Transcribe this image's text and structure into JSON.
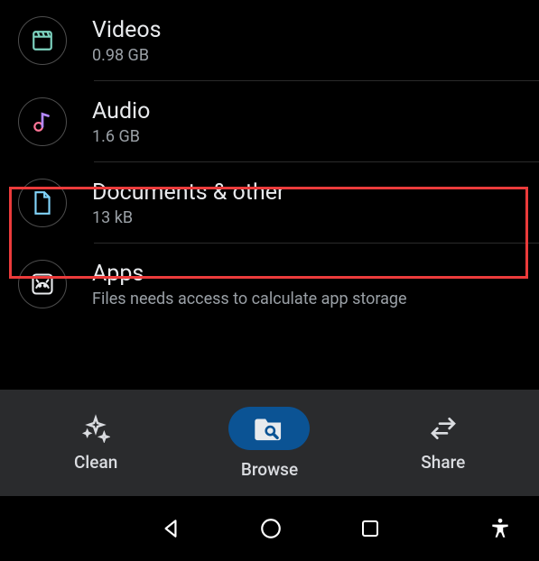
{
  "categories": [
    {
      "id": "videos",
      "label": "Videos",
      "sub": "0.98 GB",
      "icon": "clapperboard",
      "iconColor": "#7dd3c0"
    },
    {
      "id": "audio",
      "label": "Audio",
      "sub": "1.6 GB",
      "icon": "note",
      "iconColor": "#b388ff"
    },
    {
      "id": "documents",
      "label": "Documents & other",
      "sub": "13 kB",
      "icon": "doc",
      "iconColor": "#81d4fa"
    },
    {
      "id": "apps",
      "label": "Apps",
      "sub": "Files needs access to calculate app storage",
      "icon": "android",
      "iconColor": "#e8eaed"
    }
  ],
  "bottomNav": {
    "clean": "Clean",
    "browse": "Browse",
    "share": "Share",
    "activeIndex": 1
  }
}
